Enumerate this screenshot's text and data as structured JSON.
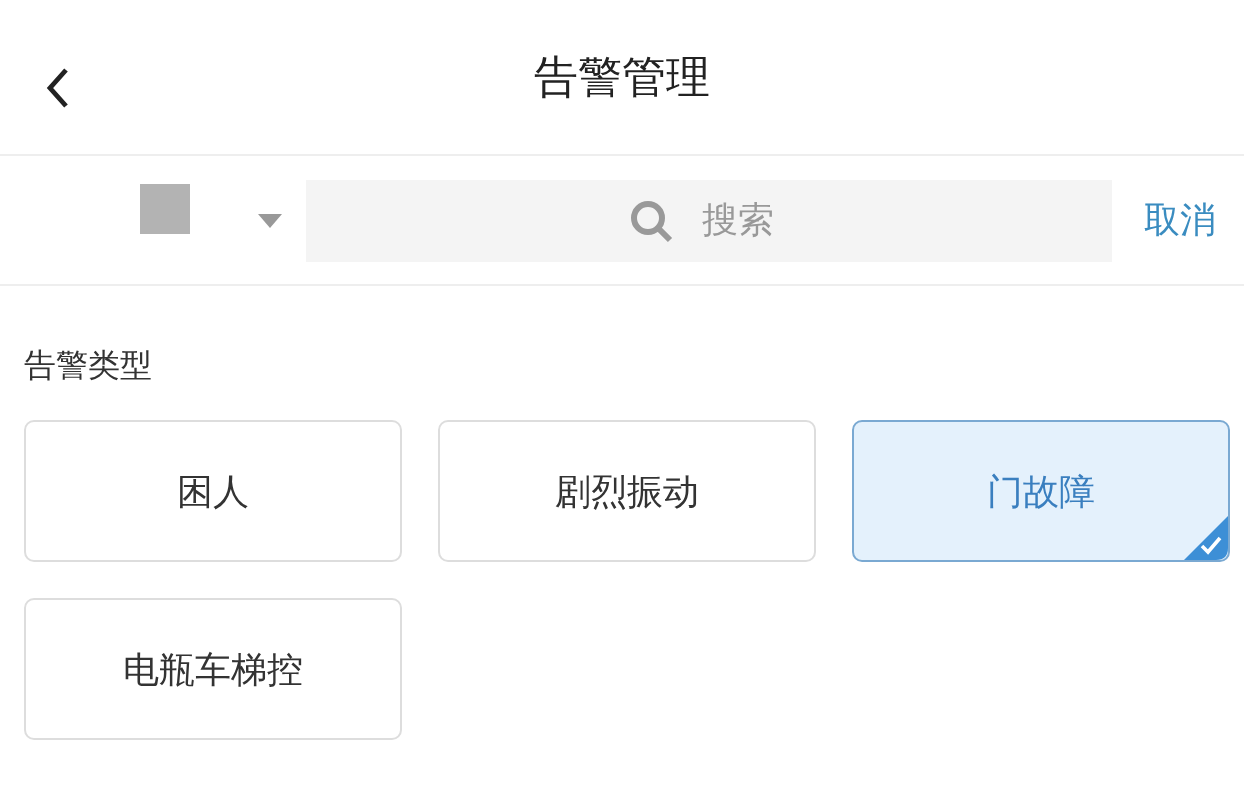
{
  "header": {
    "title": "告警管理"
  },
  "search": {
    "placeholder": "搜索",
    "cancel": "取消"
  },
  "section": {
    "title": "告警类型"
  },
  "types": [
    {
      "label": "困人",
      "selected": false
    },
    {
      "label": "剧烈振动",
      "selected": false
    },
    {
      "label": "门故障",
      "selected": true
    },
    {
      "label": "电瓶车梯控",
      "selected": false
    }
  ]
}
